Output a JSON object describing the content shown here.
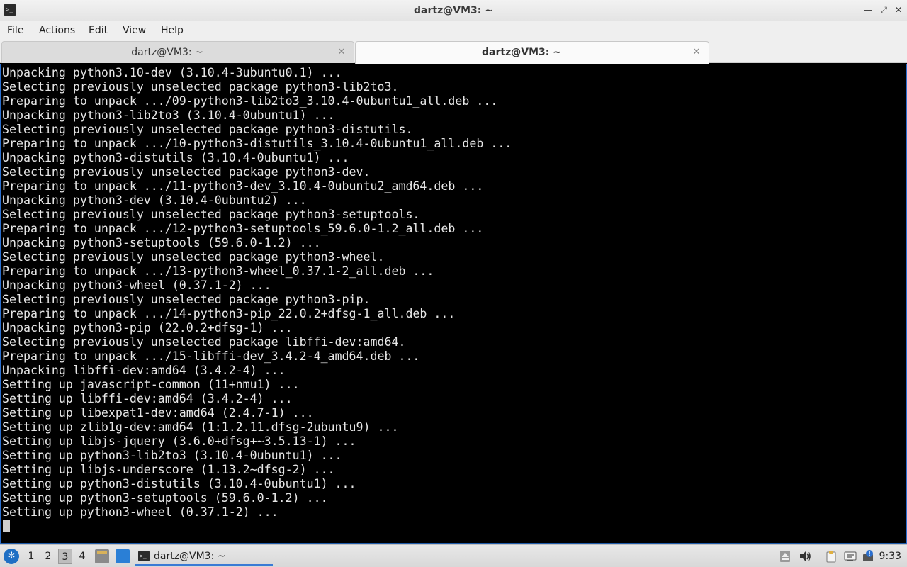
{
  "window": {
    "title": "dartz@VM3: ~",
    "icon": "terminal-icon"
  },
  "menu": [
    "File",
    "Actions",
    "Edit",
    "View",
    "Help"
  ],
  "tabs": [
    {
      "label": "dartz@VM3: ~",
      "active": false
    },
    {
      "label": "dartz@VM3: ~",
      "active": true
    }
  ],
  "terminal": {
    "background": "#000000",
    "foreground": "#e6e6e6",
    "lines": [
      "Unpacking python3.10-dev (3.10.4-3ubuntu0.1) ...",
      "Selecting previously unselected package python3-lib2to3.",
      "Preparing to unpack .../09-python3-lib2to3_3.10.4-0ubuntu1_all.deb ...",
      "Unpacking python3-lib2to3 (3.10.4-0ubuntu1) ...",
      "Selecting previously unselected package python3-distutils.",
      "Preparing to unpack .../10-python3-distutils_3.10.4-0ubuntu1_all.deb ...",
      "Unpacking python3-distutils (3.10.4-0ubuntu1) ...",
      "Selecting previously unselected package python3-dev.",
      "Preparing to unpack .../11-python3-dev_3.10.4-0ubuntu2_amd64.deb ...",
      "Unpacking python3-dev (3.10.4-0ubuntu2) ...",
      "Selecting previously unselected package python3-setuptools.",
      "Preparing to unpack .../12-python3-setuptools_59.6.0-1.2_all.deb ...",
      "Unpacking python3-setuptools (59.6.0-1.2) ...",
      "Selecting previously unselected package python3-wheel.",
      "Preparing to unpack .../13-python3-wheel_0.37.1-2_all.deb ...",
      "Unpacking python3-wheel (0.37.1-2) ...",
      "Selecting previously unselected package python3-pip.",
      "Preparing to unpack .../14-python3-pip_22.0.2+dfsg-1_all.deb ...",
      "Unpacking python3-pip (22.0.2+dfsg-1) ...",
      "Selecting previously unselected package libffi-dev:amd64.",
      "Preparing to unpack .../15-libffi-dev_3.4.2-4_amd64.deb ...",
      "Unpacking libffi-dev:amd64 (3.4.2-4) ...",
      "Setting up javascript-common (11+nmu1) ...",
      "Setting up libffi-dev:amd64 (3.4.2-4) ...",
      "Setting up libexpat1-dev:amd64 (2.4.7-1) ...",
      "Setting up zlib1g-dev:amd64 (1:1.2.11.dfsg-2ubuntu9) ...",
      "Setting up libjs-jquery (3.6.0+dfsg+~3.5.13-1) ...",
      "Setting up python3-lib2to3 (3.10.4-0ubuntu1) ...",
      "Setting up libjs-underscore (1.13.2~dfsg-2) ...",
      "Setting up python3-distutils (3.10.4-0ubuntu1) ...",
      "Setting up python3-setuptools (59.6.0-1.2) ...",
      "Setting up python3-wheel (0.37.1-2) ..."
    ]
  },
  "taskbar": {
    "workspaces": [
      "1",
      "2",
      "3",
      "4"
    ],
    "active_workspace": "3",
    "task_label": "dartz@VM3: ~",
    "clock": "9:33",
    "accent": "#3a7bd5"
  }
}
